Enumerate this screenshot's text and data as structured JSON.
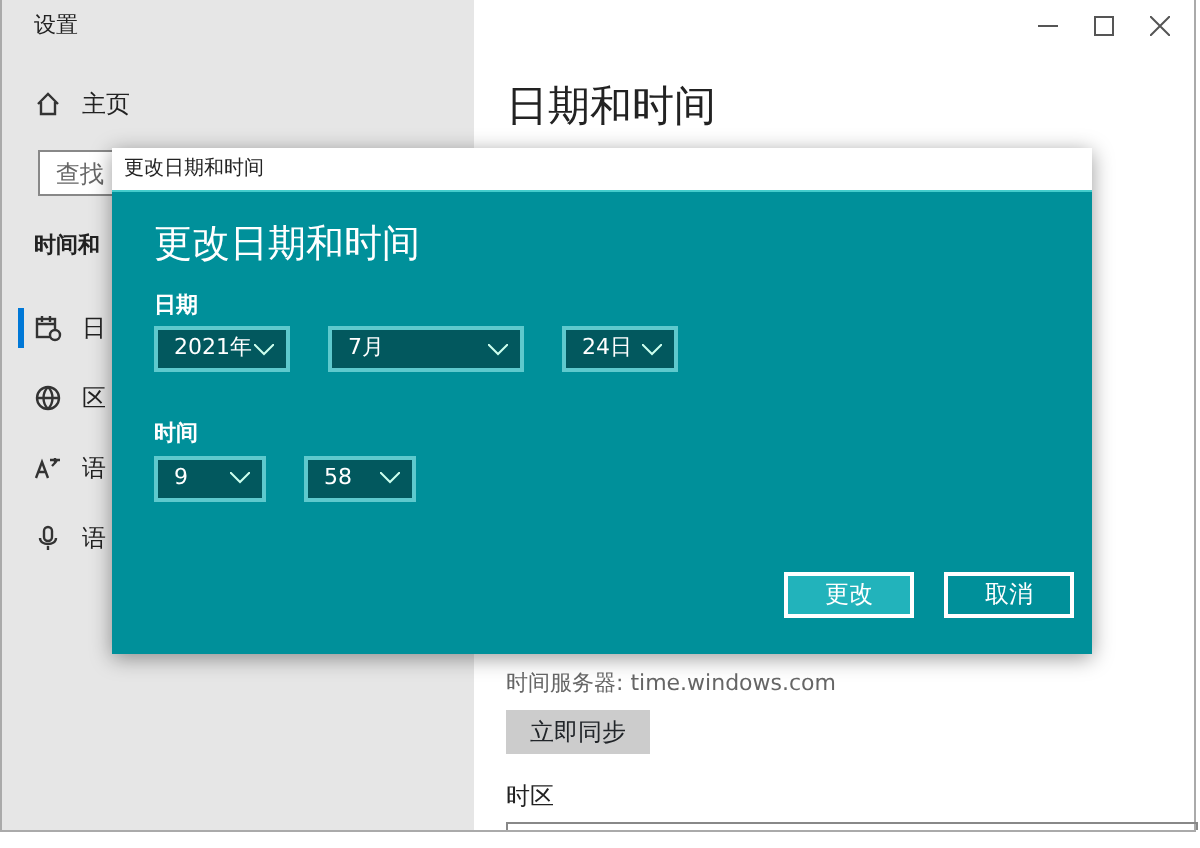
{
  "window": {
    "title": "设置"
  },
  "sidebar": {
    "home": "主页",
    "search": {
      "placeholder": "查找"
    },
    "section": "时间和",
    "items": [
      {
        "label": "日",
        "kind": "calendar",
        "selected": true
      },
      {
        "label": "区",
        "kind": "globe",
        "selected": false
      },
      {
        "label": "语",
        "kind": "language",
        "selected": false
      },
      {
        "label": "语",
        "kind": "microphone",
        "selected": false
      }
    ]
  },
  "page": {
    "title": "日期和时间",
    "server_text": "时间服务器: time.windows.com",
    "sync_button": "立即同步",
    "timezone_label": "时区"
  },
  "dialog": {
    "title": "更改日期和时间",
    "heading": "更改日期和时间",
    "date_label": "日期",
    "date_fields": [
      {
        "value": "2021年",
        "kind": "narrow"
      },
      {
        "value": "7月",
        "kind": "wide"
      },
      {
        "value": "24日",
        "kind": "narrow"
      }
    ],
    "time_label": "时间",
    "time_fields": [
      {
        "value": "9"
      },
      {
        "value": "58"
      }
    ],
    "buttons": [
      {
        "label": "更改",
        "kind": "primary"
      },
      {
        "label": "取消",
        "kind": "secondary"
      }
    ]
  }
}
